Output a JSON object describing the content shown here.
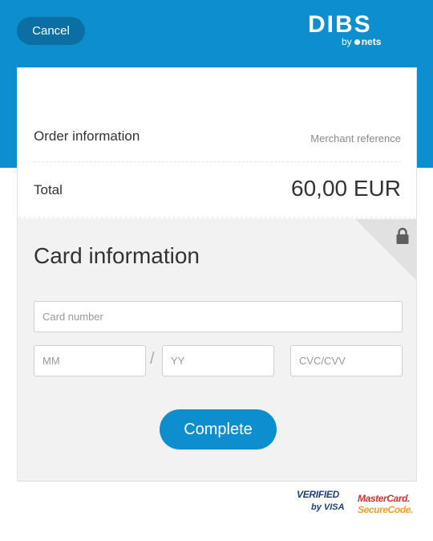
{
  "header": {
    "cancel_label": "Cancel",
    "logo_main": "DIBS",
    "logo_by": "by",
    "logo_nets": "nets"
  },
  "order": {
    "label": "Order information",
    "merchant_reference": "Merchant reference",
    "total_label": "Total",
    "total_value": "60,00 EUR"
  },
  "card": {
    "title": "Card information",
    "card_number_placeholder": "Card number",
    "month_placeholder": "MM",
    "year_placeholder": "YY",
    "date_separator": "/",
    "cvc_placeholder": "CVC/CVV",
    "complete_label": "Complete"
  },
  "footer": {
    "verified_line1": "VERIFIED",
    "verified_line2": "by VISA",
    "mastercard_line1": "MasterCard.",
    "mastercard_line2": "SecureCode."
  },
  "icons": [
    "lock-icon"
  ],
  "colors": {
    "brand_blue": "#0d8ecf",
    "cancel_button": "#0b6fa3",
    "card_section_bg": "#f2f2f2"
  }
}
